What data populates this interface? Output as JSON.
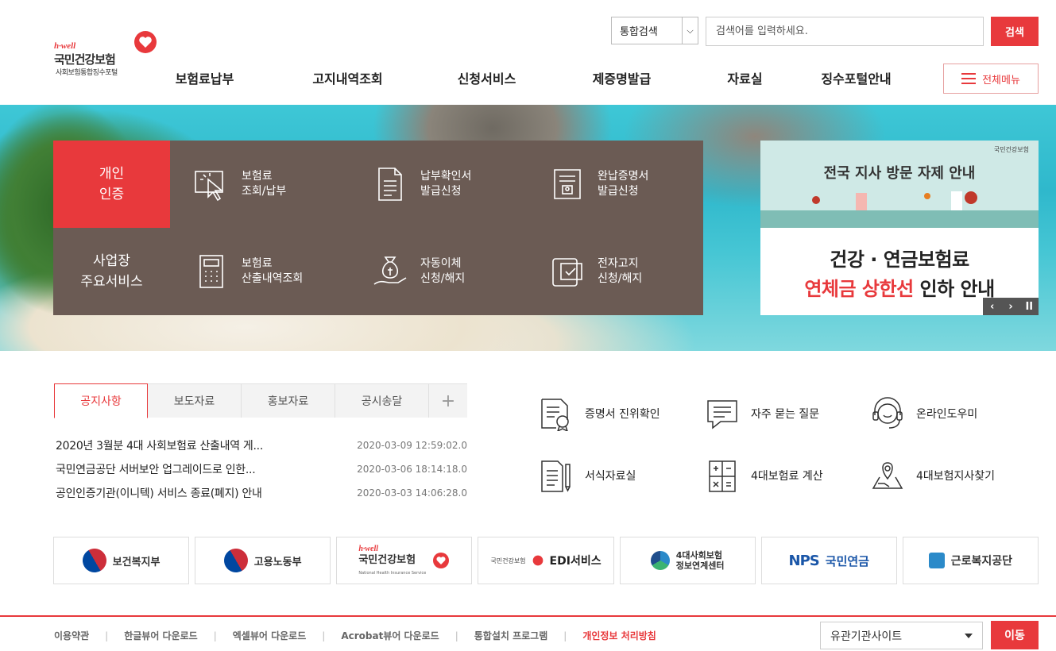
{
  "logo": {
    "hwell": "h·well",
    "name": "국민건강보험",
    "sub": "사회보험통합징수포털"
  },
  "search": {
    "select_value": "통합검색",
    "placeholder": "검색어를 입력하세요.",
    "button": "검색"
  },
  "gnb": [
    "보험료납부",
    "고지내역조회",
    "신청서비스",
    "제증명발급",
    "자료실",
    "징수포털안내"
  ],
  "allmenu": "전체메뉴",
  "quick": {
    "tab_personal": [
      "개인",
      "인증"
    ],
    "tab_business": [
      "사업장",
      "주요서비스"
    ],
    "items": [
      {
        "icon": "cursor-click-icon",
        "lines": [
          "보험료",
          "조회/납부"
        ]
      },
      {
        "icon": "document-list-icon",
        "lines": [
          "납부확인서",
          "발급신청"
        ]
      },
      {
        "icon": "certificate-scroll-icon",
        "lines": [
          "완납증명서",
          "발급신청"
        ]
      },
      {
        "icon": "calculator-icon",
        "lines": [
          "보험료",
          "산출내역조회"
        ]
      },
      {
        "icon": "money-bag-hand-icon",
        "lines": [
          "자동이체",
          "신청/해지"
        ]
      },
      {
        "icon": "e-notice-icon",
        "lines": [
          "전자고지",
          "신청/해지"
        ]
      }
    ]
  },
  "banner": {
    "title": "전국 지사 방문 자제 안내",
    "mini_logo": "국민건강보험",
    "line1": "건강 · 연금보험료",
    "line2_red": "연체금 상한선",
    "line2_rest": " 인하 안내",
    "controls": [
      "‹",
      "›",
      "II"
    ]
  },
  "notice": {
    "tabs": [
      "공지사항",
      "보도자료",
      "홍보자료",
      "공시송달"
    ],
    "plus": "+",
    "rows": [
      {
        "title": "2020년 3월분 4대 사회보험료 산출내역 게...",
        "date": "2020-03-09 12:59:02.0"
      },
      {
        "title": "국민연금공단 서버보안 업그레이드로 인한...",
        "date": "2020-03-06 18:14:18.0"
      },
      {
        "title": "공인인증기관(이니텍) 서비스 종료(폐지) 안내",
        "date": "2020-03-03 14:06:28.0"
      }
    ]
  },
  "services": [
    {
      "icon": "certificate-verify-icon",
      "label": "증명서 진위확인"
    },
    {
      "icon": "faq-chat-icon",
      "label": "자주 묻는 질문"
    },
    {
      "icon": "headset-icon",
      "label": "온라인도우미"
    },
    {
      "icon": "form-document-icon",
      "label": "서식자료실"
    },
    {
      "icon": "calculator-icon",
      "label": "4대보험료 계산"
    },
    {
      "icon": "map-pin-icon",
      "label": "4대보험지사찾기"
    }
  ],
  "orgs": {
    "mohw": "보건복지부",
    "moel": "고용노동부",
    "nhis_hwell": "h·well",
    "nhis_name": "국민건강보험",
    "nhis_sub": "National Health Insurance Service",
    "edi_small": "국민건강보험",
    "edi": "EDI서비스",
    "four_line1": "4대사회보험",
    "four_line2": "정보연계센터",
    "nps_mark": "NPS",
    "nps_name": "국민연금",
    "kcomwel": "근로복지공단"
  },
  "footer": {
    "links": [
      "이용약관",
      "한글뷰어 다운로드",
      "엑셀뷰어 다운로드",
      "Acrobat뷰어 다운로드",
      "통합설치 프로그램",
      "개인정보 처리방침"
    ],
    "related": "유관기관사이트",
    "go": "이동"
  },
  "colors": {
    "accent": "#e8393c",
    "panel": "#6b5b54"
  }
}
